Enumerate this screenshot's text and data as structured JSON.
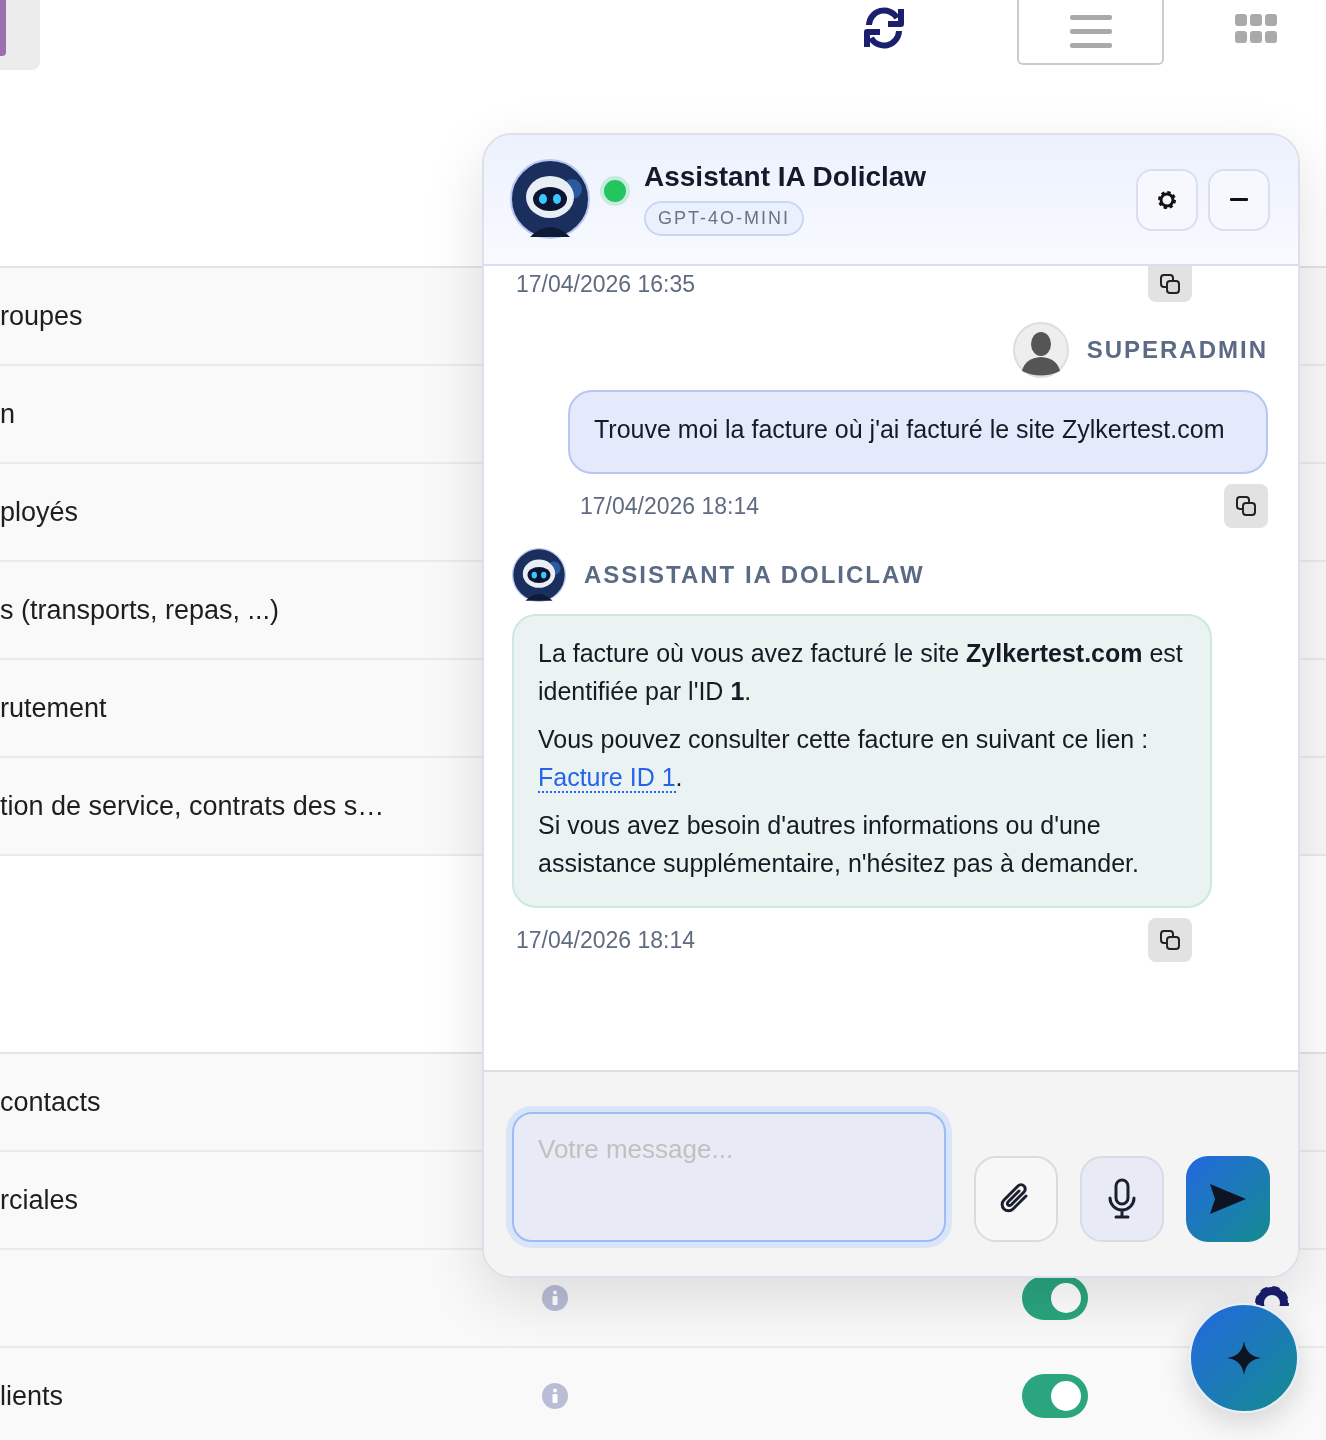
{
  "rows_top": [
    {
      "label": "roupes"
    },
    {
      "label": "n"
    },
    {
      "label": "ployés"
    },
    {
      "label": "s (transports, repas, ...)"
    },
    {
      "label": "rutement"
    },
    {
      "label": "tion de service, contrats des s…"
    }
  ],
  "rows_bottom": [
    {
      "label": "contacts"
    },
    {
      "label": "rciales"
    },
    {
      "toggle": {
        "on": true
      }
    },
    {
      "label": "lients",
      "toggle": {
        "on": true
      }
    }
  ],
  "chat": {
    "title": "Assistant IA Doliclaw",
    "model": "GPT-4O-MINI",
    "online": true,
    "messages": [
      {
        "kind": "assistant",
        "time": "17/04/2026 16:35"
      },
      {
        "kind": "user",
        "author": "SUPERADMIN",
        "paragraphs": [
          {
            "text": "Trouve moi la facture où j'ai facturé le site Zylkertest.com"
          }
        ],
        "time": "17/04/2026 18:14"
      },
      {
        "kind": "assistant",
        "author": "ASSISTANT IA DOLICLAW",
        "paragraphs": [
          {
            "text": "La facture où vous avez facturé le site **Zylkertest.com** est identifiée par l'ID **1**."
          },
          {
            "text": "Vous pouvez consulter cette facture en suivant ce lien : ",
            "link": "Facture ID 1",
            "after": "."
          },
          {
            "text": "Si vous avez besoin d'autres informations ou d'une assistance supplémentaire, n'hésitez pas à demander."
          }
        ],
        "time": "17/04/2026 18:14"
      }
    ],
    "input": {
      "placeholder": "Votre message..."
    }
  }
}
